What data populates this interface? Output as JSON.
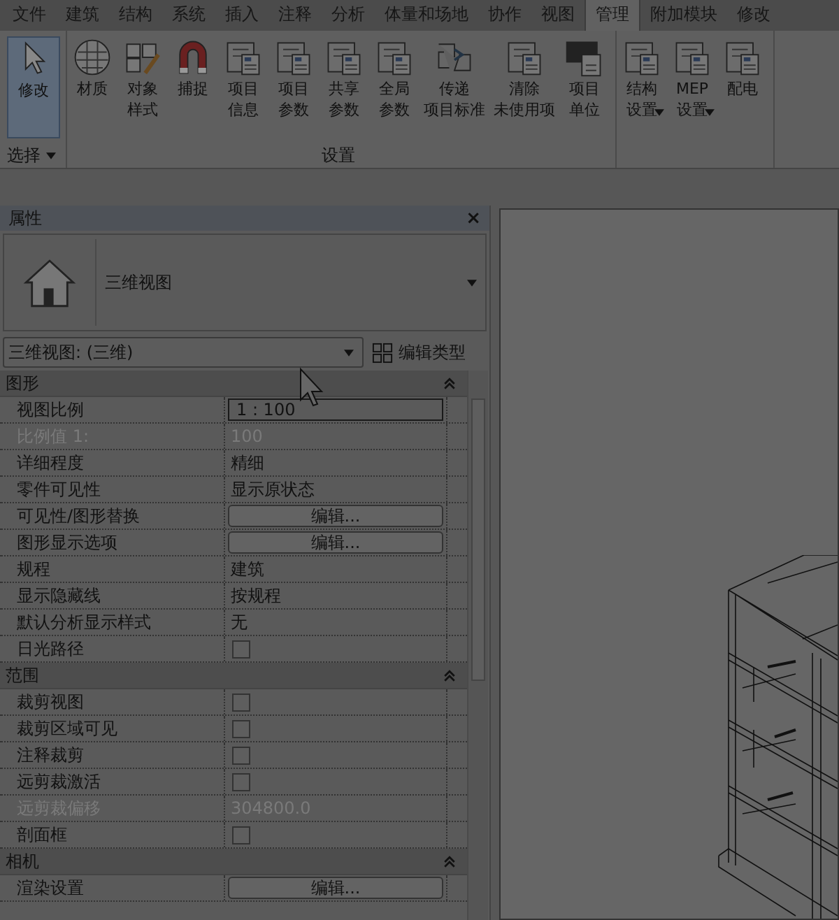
{
  "tabs": [
    {
      "label": "文件",
      "selected": false
    },
    {
      "label": "建筑",
      "selected": false
    },
    {
      "label": "结构",
      "selected": false
    },
    {
      "label": "系统",
      "selected": false
    },
    {
      "label": "插入",
      "selected": false
    },
    {
      "label": "注释",
      "selected": false
    },
    {
      "label": "分析",
      "selected": false
    },
    {
      "label": "体量和场地",
      "selected": false
    },
    {
      "label": "协作",
      "selected": false
    },
    {
      "label": "视图",
      "selected": false
    },
    {
      "label": "管理",
      "selected": true
    },
    {
      "label": "附加模块",
      "selected": false
    },
    {
      "label": "修改",
      "selected": false
    }
  ],
  "ribbon": [
    {
      "label": "选择",
      "dropdown": true,
      "buttons": [
        {
          "lines": [
            "修改"
          ],
          "selected": true,
          "dropdown": false
        }
      ]
    },
    {
      "label": "设置",
      "dropdown": false,
      "buttons": [
        {
          "lines": [
            "材质"
          ],
          "selected": false,
          "dropdown": false
        },
        {
          "lines": [
            "对象",
            "样式"
          ],
          "selected": false,
          "dropdown": false
        },
        {
          "lines": [
            "捕捉"
          ],
          "selected": false,
          "dropdown": false
        },
        {
          "lines": [
            "项目",
            "信息"
          ],
          "selected": false,
          "dropdown": false
        },
        {
          "lines": [
            "项目",
            "参数"
          ],
          "selected": false,
          "dropdown": false
        },
        {
          "lines": [
            "共享",
            "参数"
          ],
          "selected": false,
          "dropdown": false
        },
        {
          "lines": [
            "全局",
            "参数"
          ],
          "selected": false,
          "dropdown": false
        },
        {
          "lines": [
            "传递",
            "项目标准"
          ],
          "selected": false,
          "dropdown": false
        },
        {
          "lines": [
            "清除",
            "未使用项"
          ],
          "selected": false,
          "dropdown": false
        },
        {
          "lines": [
            "项目",
            "单位"
          ],
          "selected": false,
          "dropdown": false
        }
      ]
    },
    {
      "buttons": [
        {
          "lines": [
            "结构",
            "设置"
          ],
          "selected": false,
          "dropdown": true
        },
        {
          "lines": [
            "MEP",
            "设置"
          ],
          "selected": false,
          "dropdown": true
        },
        {
          "lines": [
            "配电"
          ],
          "selected": false,
          "dropdown": false
        }
      ]
    }
  ],
  "properties": {
    "title": "属性",
    "close": "×",
    "type_name": "三维视图",
    "selector": "三维视图: (三维)",
    "edit_type": "编辑类型",
    "groups": [
      {
        "name": "图形",
        "rows": [
          {
            "label": "视图比例",
            "kind": "input",
            "value": "1 : 100",
            "disabled": false
          },
          {
            "label": "比例值 1:",
            "kind": "text",
            "value": "100",
            "disabled": true
          },
          {
            "label": "详细程度",
            "kind": "text",
            "value": "精细",
            "disabled": false
          },
          {
            "label": "零件可见性",
            "kind": "text",
            "value": "显示原状态",
            "disabled": false
          },
          {
            "label": "可见性/图形替换",
            "kind": "button",
            "value": "编辑...",
            "disabled": false
          },
          {
            "label": "图形显示选项",
            "kind": "button",
            "value": "编辑...",
            "disabled": false
          },
          {
            "label": "规程",
            "kind": "text",
            "value": "建筑",
            "disabled": false
          },
          {
            "label": "显示隐藏线",
            "kind": "text",
            "value": "按规程",
            "disabled": false
          },
          {
            "label": "默认分析显示样式",
            "kind": "text",
            "value": "无",
            "disabled": false
          },
          {
            "label": "日光路径",
            "kind": "checkbox",
            "checked": false,
            "disabled": false
          }
        ]
      },
      {
        "name": "范围",
        "rows": [
          {
            "label": "裁剪视图",
            "kind": "checkbox",
            "checked": false,
            "disabled": false
          },
          {
            "label": "裁剪区域可见",
            "kind": "checkbox",
            "checked": false,
            "disabled": false
          },
          {
            "label": "注释裁剪",
            "kind": "checkbox",
            "checked": false,
            "disabled": false
          },
          {
            "label": "远剪裁激活",
            "kind": "checkbox",
            "checked": false,
            "disabled": false
          },
          {
            "label": "远剪裁偏移",
            "kind": "text",
            "value": "304800.0",
            "disabled": true
          },
          {
            "label": "剖面框",
            "kind": "checkbox",
            "checked": false,
            "disabled": false
          }
        ]
      },
      {
        "name": "相机",
        "rows": [
          {
            "label": "渲染设置",
            "kind": "button",
            "value": "编辑...",
            "disabled": false
          }
        ]
      }
    ]
  }
}
